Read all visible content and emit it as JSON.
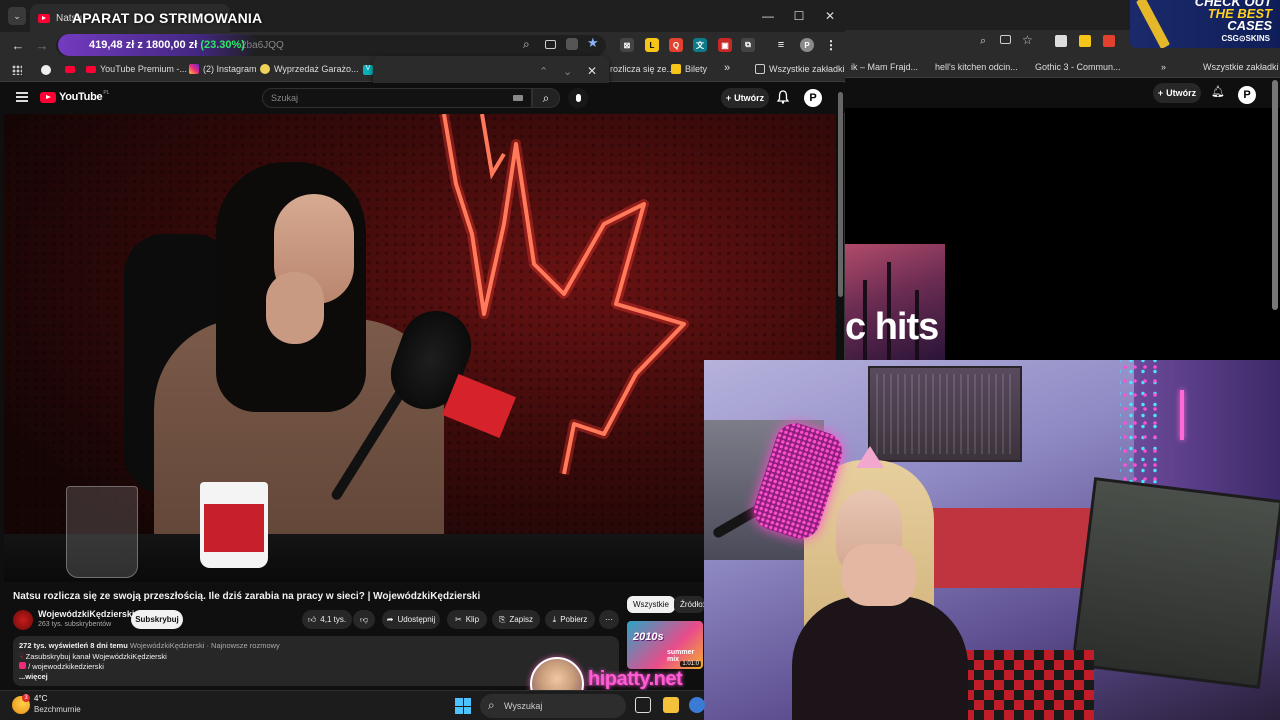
{
  "overlay": {
    "title": "APARAT DO STRIMOWANIA"
  },
  "browser": {
    "tab_title": "Natsu",
    "url_fragment": "2ba6JQQ",
    "price": "419,48 zł",
    "goal": "z 1800,00 zł",
    "percent": "(23.30%)"
  },
  "bookmarks": [
    {
      "label": "YouTube Premium -...",
      "icon": "youtube-icon"
    },
    {
      "label": "(2) Instagram",
      "icon": "instagram-icon"
    },
    {
      "label": "Wyprzedaż Garażo...",
      "icon": "tag-icon"
    },
    {
      "label": "rozlicza się ze...",
      "icon": "youtube-icon"
    },
    {
      "label": "Bilety",
      "icon": "ticket-icon"
    },
    {
      "label": "Wszystkie zakładki",
      "icon": "folder-icon"
    }
  ],
  "bg_bookmarks": [
    {
      "label": "ik – Mam Frajd..."
    },
    {
      "label": "hell's kitchen odcin..."
    },
    {
      "label": "Gothic 3 - Commun..."
    },
    {
      "label": "Wszystkie zakładki"
    }
  ],
  "bg_thumb_text": "c hits",
  "youtube": {
    "logo": "YouTube",
    "logo_region": "PL",
    "search_placeholder": "Szukaj",
    "create_label": "Utwórz",
    "avatar_letter": "P"
  },
  "video": {
    "title": "Natsu rozlicza się ze swoją przeszłością. Ile dziś zarabia na pracy w sieci? | WojewódzkiKędzierski",
    "channel": "WojewódzkiKędzierski",
    "subscribers": "263 tys. subskrybentów",
    "subscribe_label": "Subskrybuj",
    "likes": "4,1 tys.",
    "share_label": "Udostępnij",
    "clip_label": "Klip",
    "save_label": "Zapisz",
    "download_label": "Pobierz",
    "more_label": "⋯"
  },
  "description": {
    "views_date": "272 tys. wyświetleń  8 dni temu",
    "tags": "WojewódzkiKędzierski · Najnowsze rozmowy",
    "line1": "Zasubskrybuj kanał WojewódzkiKędzierski",
    "line2": "/ wojewodzkikedzierski",
    "more": "...więcej"
  },
  "chips": {
    "all": "Wszystkie",
    "source": "Źródło:"
  },
  "recommended": {
    "thumb_text": "2010s",
    "thumb_text2": "summer mix",
    "duration": "1:01:0"
  },
  "background_yt": {
    "create_label": "Utwórz",
    "avatar_letter": "P"
  },
  "ad": {
    "line1": "CHECK OUT",
    "line2": "THE BEST",
    "line3": "CASES",
    "brand": "CSG⊙SKINS"
  },
  "streamer": {
    "brand": "hipatty.net"
  },
  "taskbar": {
    "temperature": "4°C",
    "weather": "Bezchmurnie",
    "weather_badge": "3",
    "search_placeholder": "Wyszukaj"
  }
}
